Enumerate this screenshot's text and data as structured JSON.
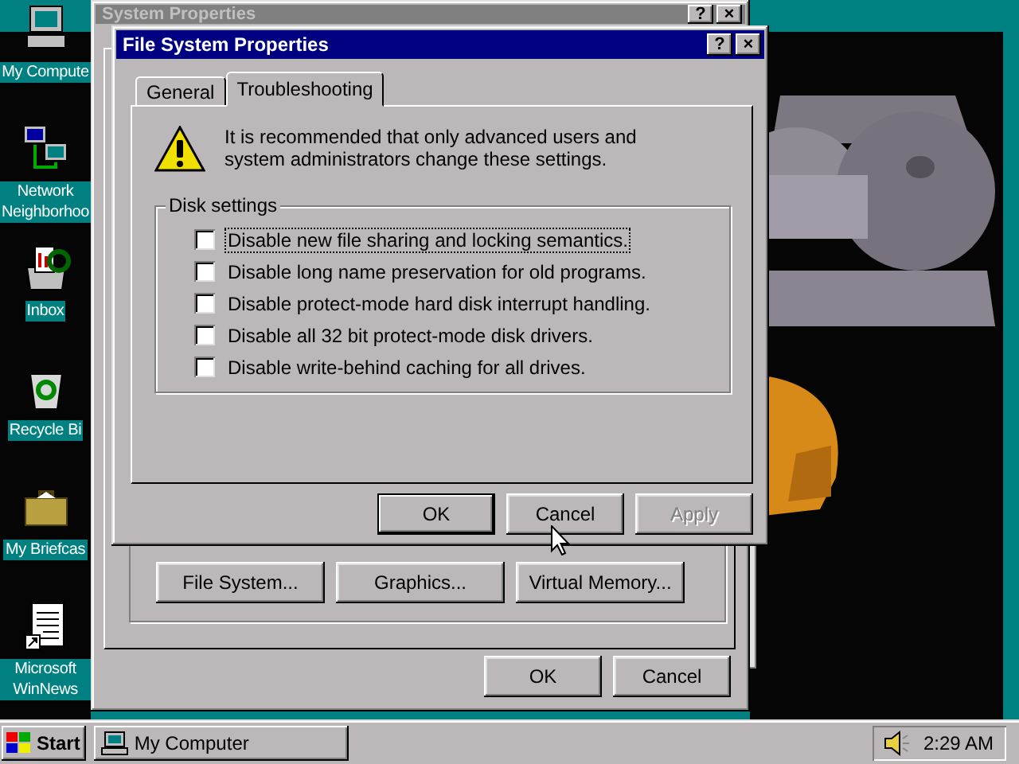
{
  "desktop_icons": [
    {
      "label": "My Compute",
      "kind": "computer"
    },
    {
      "label": "Network Neighborhoo",
      "kind": "network"
    },
    {
      "label": "Inbox",
      "kind": "inbox"
    },
    {
      "label": "Recycle Bi",
      "kind": "recycle"
    },
    {
      "label": "My Briefcas",
      "kind": "briefcase"
    },
    {
      "label": "Microsoft WinNews",
      "kind": "document"
    }
  ],
  "system_properties": {
    "title": "System Properties",
    "active": false,
    "title_buttons": [
      "?",
      "×"
    ],
    "advanced_buttons": [
      {
        "label": "File System..."
      },
      {
        "label": "Graphics..."
      },
      {
        "label": "Virtual Memory..."
      }
    ],
    "buttons": [
      {
        "label": "OK"
      },
      {
        "label": "Cancel"
      }
    ]
  },
  "file_system_properties": {
    "title": "File System Properties",
    "active": true,
    "title_buttons": [
      "?",
      "×"
    ],
    "tabs": [
      {
        "label": "General",
        "selected": false
      },
      {
        "label": "Troubleshooting",
        "selected": true
      }
    ],
    "warning": "It is recommended that only advanced users and system administrators change these settings.",
    "group": "Disk settings",
    "options": [
      {
        "label": "Disable new file sharing and locking semantics.",
        "checked": false,
        "focused": true
      },
      {
        "label": "Disable long name preservation for old programs.",
        "checked": false,
        "focused": false
      },
      {
        "label": "Disable protect-mode hard disk interrupt handling.",
        "checked": false,
        "focused": false
      },
      {
        "label": "Disable all 32 bit protect-mode disk drivers.",
        "checked": false,
        "focused": false
      },
      {
        "label": "Disable write-behind caching for all drives.",
        "checked": false,
        "focused": false
      }
    ],
    "buttons": [
      {
        "label": "OK",
        "default": true,
        "disabled": false
      },
      {
        "label": "Cancel",
        "default": false,
        "disabled": false
      },
      {
        "label": "Apply",
        "default": false,
        "disabled": true
      }
    ]
  },
  "taskbar": {
    "start": "Start",
    "tasks": [
      {
        "label": "My Computer",
        "selected": false
      }
    ],
    "clock": "2:29 AM"
  }
}
